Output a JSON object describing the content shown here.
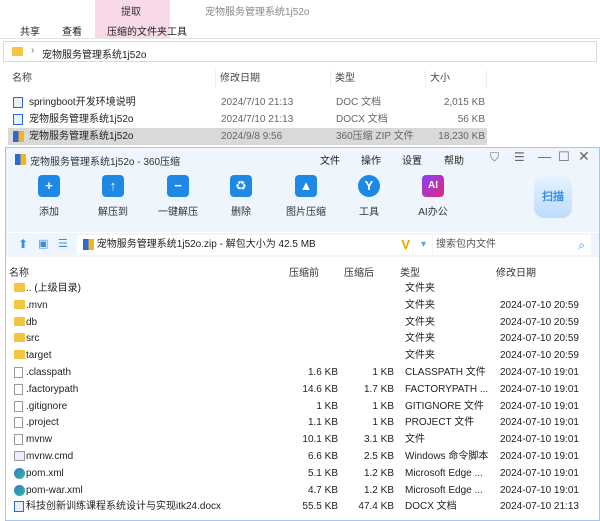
{
  "explorer": {
    "ribbon_tabs": [
      "共享",
      "查看"
    ],
    "context_group": "提取",
    "context_tab": "压缩的文件夹工具",
    "window_title": "宠物服务管理系统1j52o",
    "breadcrumb": "宠物服务管理系统1j52o",
    "columns": [
      "名称",
      "修改日期",
      "类型",
      "大小"
    ],
    "files": [
      {
        "name": "springboot开发环境说明",
        "date": "2024/7/10 21:13",
        "type": "DOC 文档",
        "size": "2,015 KB",
        "icon": "word-icon"
      },
      {
        "name": "宠物服务管理系统1j52o",
        "date": "2024/7/10 21:13",
        "type": "DOCX 文档",
        "size": "56 KB",
        "icon": "word-icon"
      },
      {
        "name": "宠物服务管理系统1j52o",
        "date": "2024/9/8 9:56",
        "type": "360压缩 ZIP 文件",
        "size": "18,230 KB",
        "icon": "zip-icon"
      }
    ]
  },
  "zip": {
    "title": "宠物服务管理系统1j52o - 360压缩",
    "menu": [
      "文件",
      "操作",
      "设置",
      "帮助"
    ],
    "toolbar": [
      {
        "label": "添加",
        "glyph": "+",
        "color": "#1e88e5"
      },
      {
        "label": "解压到",
        "glyph": "↑",
        "color": "#1e88e5"
      },
      {
        "label": "一键解压",
        "glyph": "−",
        "color": "#1e88e5"
      },
      {
        "label": "删除",
        "glyph": "♻",
        "color": "#1e88e5"
      },
      {
        "label": "图片压缩",
        "glyph": "▲",
        "color": "#1e88e5"
      },
      {
        "label": "工具",
        "glyph": "Y",
        "color": "#1e88e5"
      },
      {
        "label": "AI办公",
        "glyph": "AI",
        "color": "#d63384"
      }
    ],
    "scan_label": "扫描",
    "path": "宠物服务管理系统1j52o.zip - 解包大小为 42.5 MB",
    "search_placeholder": "搜索包内文件",
    "columns": [
      "名称",
      "压缩前",
      "压缩后",
      "类型",
      "修改日期"
    ],
    "rows": [
      {
        "name": ".. (上级目录)",
        "before": "",
        "after": "",
        "type": "文件夹",
        "date": "",
        "icon": "folder"
      },
      {
        "name": ".mvn",
        "before": "",
        "after": "",
        "type": "文件夹",
        "date": "2024-07-10 20:59",
        "icon": "folder"
      },
      {
        "name": "db",
        "before": "",
        "after": "",
        "type": "文件夹",
        "date": "2024-07-10 20:59",
        "icon": "folder"
      },
      {
        "name": "src",
        "before": "",
        "after": "",
        "type": "文件夹",
        "date": "2024-07-10 20:59",
        "icon": "folder"
      },
      {
        "name": "target",
        "before": "",
        "after": "",
        "type": "文件夹",
        "date": "2024-07-10 20:59",
        "icon": "folder"
      },
      {
        "name": ".classpath",
        "before": "1.6 KB",
        "after": "1 KB",
        "type": "CLASSPATH 文件",
        "date": "2024-07-10 19:01",
        "icon": "file"
      },
      {
        "name": ".factorypath",
        "before": "14.6 KB",
        "after": "1.7 KB",
        "type": "FACTORYPATH ...",
        "date": "2024-07-10 19:01",
        "icon": "file"
      },
      {
        "name": ".gitignore",
        "before": "1 KB",
        "after": "1 KB",
        "type": "GITIGNORE 文件",
        "date": "2024-07-10 19:01",
        "icon": "file"
      },
      {
        "name": ".project",
        "before": "1.1 KB",
        "after": "1 KB",
        "type": "PROJECT 文件",
        "date": "2024-07-10 19:01",
        "icon": "file"
      },
      {
        "name": "mvnw",
        "before": "10.1 KB",
        "after": "3.1 KB",
        "type": "文件",
        "date": "2024-07-10 19:01",
        "icon": "file"
      },
      {
        "name": "mvnw.cmd",
        "before": "6.6 KB",
        "after": "2.5 KB",
        "type": "Windows 命令脚本",
        "date": "2024-07-10 19:01",
        "icon": "cmd"
      },
      {
        "name": "pom.xml",
        "before": "5.1 KB",
        "after": "1.2 KB",
        "type": "Microsoft Edge ...",
        "date": "2024-07-10 19:01",
        "icon": "edge"
      },
      {
        "name": "pom-war.xml",
        "before": "4.7 KB",
        "after": "1.2 KB",
        "type": "Microsoft Edge ...",
        "date": "2024-07-10 19:01",
        "icon": "edge"
      },
      {
        "name": "科技创新训练课程系统设计与实现itk24.docx",
        "before": "55.5 KB",
        "after": "47.4 KB",
        "type": "DOCX 文档",
        "date": "2024-07-10 21:13",
        "icon": "word"
      }
    ]
  }
}
